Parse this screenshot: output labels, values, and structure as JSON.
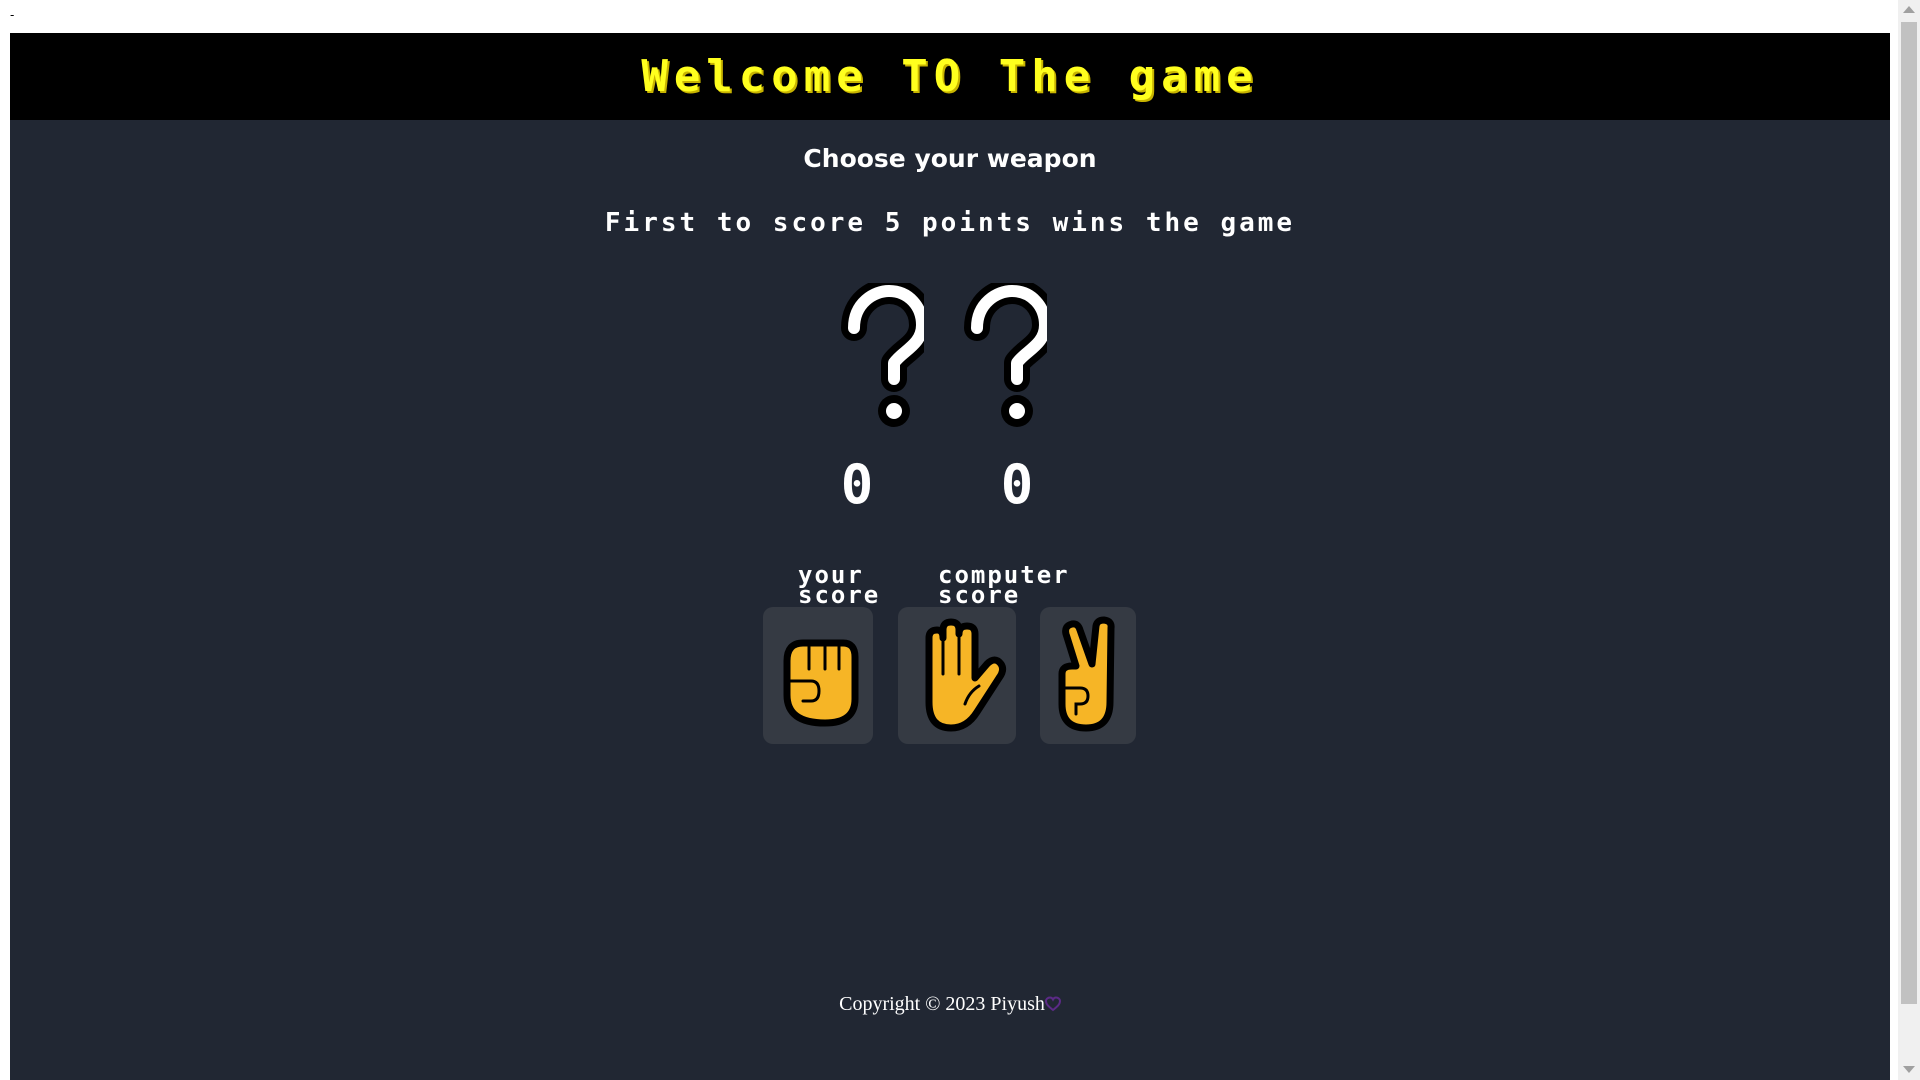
{
  "top_mark": "-",
  "header": {
    "title": "Welcome TO The game"
  },
  "subtitle": "Choose your weapon",
  "rules": "First to score 5 points wins the game",
  "choices": {
    "player_icon": "question-mark-icon",
    "computer_icon": "question-mark-icon"
  },
  "scores": {
    "player": "0",
    "computer": "0",
    "player_label": "your score",
    "computer_label": "computer score"
  },
  "weapons": [
    {
      "name": "rock",
      "icon": "raised-fist-icon"
    },
    {
      "name": "paper",
      "icon": "raised-hand-icon"
    },
    {
      "name": "scissors",
      "icon": "victory-hand-icon"
    }
  ],
  "footer": {
    "copyright": "Copyright © 2023 Piyush"
  },
  "colors": {
    "background": "#212733",
    "banner": "#000000",
    "title": "#ffff1e",
    "weapon_button": "#353a43",
    "hand": "#f6b526"
  }
}
